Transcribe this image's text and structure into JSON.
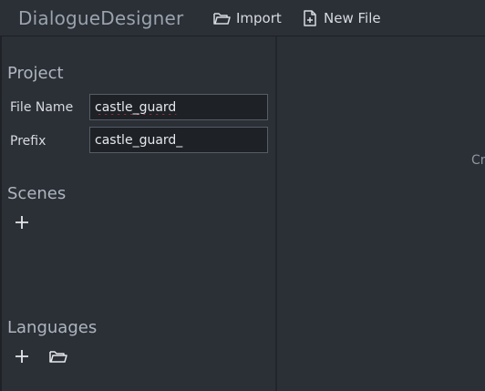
{
  "app": {
    "title": "DialogueDesigner"
  },
  "toolbar": {
    "import_label": "Import",
    "new_file_label": "New File"
  },
  "project": {
    "title": "Project",
    "file_name_label": "File Name",
    "file_name_value": "castle_guard",
    "prefix_label": "Prefix",
    "prefix_value": "castle_guard_"
  },
  "scenes": {
    "title": "Scenes"
  },
  "languages": {
    "title": "Languages"
  },
  "right_panel": {
    "hint_text": "Cr"
  },
  "icons": {
    "import": "folder-open-icon",
    "new_file": "file-plus-icon",
    "add_scene": "plus-icon",
    "add_language": "plus-icon",
    "open_language": "folder-open-icon"
  }
}
